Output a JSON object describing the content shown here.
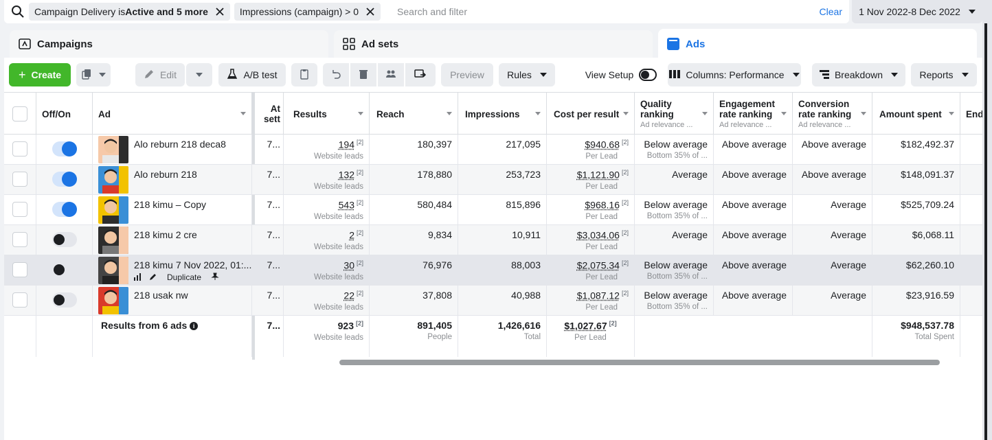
{
  "filters": {
    "chips": [
      {
        "prefix": "Campaign Delivery is ",
        "bold": "Active and 5 more"
      },
      {
        "prefix": "Impressions (campaign) > 0",
        "bold": ""
      }
    ],
    "search_placeholder": "Search and filter",
    "clear_label": "Clear",
    "date_range": "1 Nov 2022-8 Dec 2022"
  },
  "tabs": [
    {
      "label": "Campaigns",
      "icon": "folder-icon",
      "active": false
    },
    {
      "label": "Ad sets",
      "icon": "grid-icon",
      "active": false
    },
    {
      "label": "Ads",
      "icon": "ad-icon",
      "active": true
    }
  ],
  "toolbar": {
    "create_label": "Create",
    "edit_label": "Edit",
    "ab_test_label": "A/B test",
    "preview_label": "Preview",
    "rules_label": "Rules",
    "view_setup_label": "View Setup",
    "columns_label": "Columns: Performance",
    "breakdown_label": "Breakdown",
    "reports_label": "Reports"
  },
  "table": {
    "headers": {
      "offon": "Off/On",
      "ad": "Ad",
      "attr": "At",
      "attr2": "sett",
      "results": "Results",
      "reach": "Reach",
      "impressions": "Impressions",
      "cpr": "Cost per result",
      "quality": "Quality",
      "quality2": "ranking",
      "quality_sub": "Ad relevance ...",
      "engagement": "Engagement",
      "engagement2": "rate ranking",
      "engagement_sub": "Ad relevance ...",
      "conversion": "Conversion",
      "conversion2": "rate ranking",
      "conversion_sub": "Ad relevance ...",
      "amount": "Amount spent",
      "end": "End"
    },
    "rows": [
      {
        "on": true,
        "name": "Alo reburn 218 deca8",
        "attr": "7...",
        "results": "194",
        "results_sup": "[2]",
        "results_sub": "Website leads",
        "reach": "180,397",
        "impressions": "217,095",
        "cpr": "$940.68",
        "cpr_sup": "[2]",
        "cpr_sub": "Per Lead",
        "quality": "Below average",
        "quality_sub": "Bottom 35% of ...",
        "engagement": "Above average",
        "conversion": "Above average",
        "amount": "$182,492.37"
      },
      {
        "on": true,
        "name": "Alo reburn 218",
        "attr": "7...",
        "results": "132",
        "results_sup": "[2]",
        "results_sub": "Website leads",
        "reach": "178,880",
        "impressions": "253,723",
        "cpr": "$1,121.90",
        "cpr_sup": "[2]",
        "cpr_sub": "Per Lead",
        "quality": "Average",
        "quality_sub": "",
        "engagement": "Above average",
        "conversion": "Above average",
        "amount": "$148,091.37"
      },
      {
        "on": true,
        "name": "218 kimu – Copy",
        "attr": "7...",
        "results": "543",
        "results_sup": "[2]",
        "results_sub": "Website leads",
        "reach": "580,484",
        "impressions": "815,896",
        "cpr": "$968.16",
        "cpr_sup": "[2]",
        "cpr_sub": "Per Lead",
        "quality": "Below average",
        "quality_sub": "Bottom 35% of ...",
        "engagement": "Above average",
        "conversion": "Average",
        "amount": "$525,709.24"
      },
      {
        "on": false,
        "name": "218 kimu 2 cre",
        "attr": "7...",
        "results": "2",
        "results_sup": "[2]",
        "results_sub": "Website leads",
        "reach": "9,834",
        "impressions": "10,911",
        "cpr": "$3,034.06",
        "cpr_sup": "[2]",
        "cpr_sub": "Per Lead",
        "quality": "Average",
        "quality_sub": "",
        "engagement": "Above average",
        "conversion": "Average",
        "amount": "$6,068.11"
      },
      {
        "on": false,
        "name": "218 kimu",
        "name_overlay": "7 Nov 2022, 01:...",
        "tools": {
          "duplicate": "Duplicate"
        },
        "attr": "7...",
        "results": "30",
        "results_sup": "[2]",
        "results_sub": "Website leads",
        "reach": "76,976",
        "impressions": "88,003",
        "cpr": "$2,075.34",
        "cpr_sup": "[2]",
        "cpr_sub": "Per Lead",
        "quality": "Below average",
        "quality_sub": "Bottom 35% of ...",
        "engagement": "Above average",
        "conversion": "Average",
        "amount": "$62,260.10"
      },
      {
        "on": false,
        "name": "218 usak nw",
        "attr": "7...",
        "results": "22",
        "results_sup": "[2]",
        "results_sub": "Website leads",
        "reach": "37,808",
        "impressions": "40,988",
        "cpr": "$1,087.12",
        "cpr_sup": "[2]",
        "cpr_sub": "Per Lead",
        "quality": "Below average",
        "quality_sub": "Bottom 35% of ...",
        "engagement": "Above average",
        "conversion": "Average",
        "amount": "$23,916.59"
      }
    ],
    "total": {
      "label": "Results from 6 ads",
      "attr": "7...",
      "results": "923",
      "results_sup": "[2]",
      "results_sub": "Website leads",
      "reach": "891,405",
      "reach_sub": "People",
      "impressions": "1,426,616",
      "impressions_sub": "Total",
      "cpr": "$1,027.67",
      "cpr_sup": "[2]",
      "cpr_sub": "Per Lead",
      "amount": "$948,537.78",
      "amount_sub": "Total Spent"
    }
  },
  "colors": {
    "accent": "#1b74e4",
    "create": "#42b72a"
  }
}
